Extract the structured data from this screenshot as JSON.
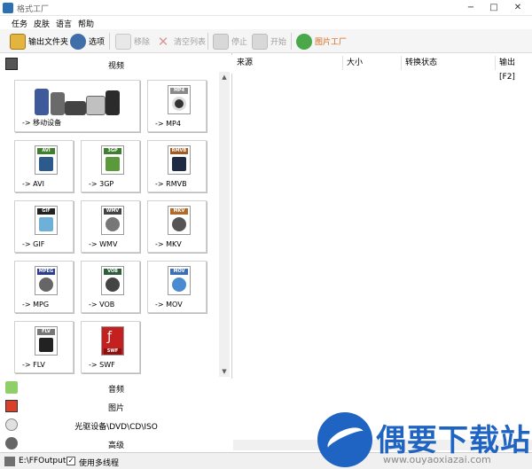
{
  "window": {
    "title": "格式工厂",
    "minimize": "−",
    "maximize": "□",
    "close": "✕"
  },
  "menu": [
    "任务",
    "皮肤",
    "语言",
    "帮助"
  ],
  "toolbar": {
    "output_folder": "输出文件夹",
    "options": "选项",
    "remove": "移除",
    "clear_list": "清空列表",
    "stop": "停止",
    "start": "开始",
    "picture_factory": "图片工厂"
  },
  "sidebar": {
    "video_label": "视频",
    "audio_label": "音频",
    "picture_label": "图片",
    "rom_label": "光驱设备\\DVD\\CD\\ISO",
    "advanced_label": "高级",
    "tiles": [
      {
        "label": "-> 移动设备",
        "tag": ""
      },
      {
        "label": "-> MP4",
        "tag": "MP4",
        "color": "#8a8a8a"
      },
      {
        "label": "-> AVI",
        "tag": "AVI",
        "color": "#3f7f2f"
      },
      {
        "label": "-> 3GP",
        "tag": "3GP",
        "color": "#3f7f2f"
      },
      {
        "label": "-> RMVB",
        "tag": "RMVB",
        "color": "#a05a22"
      },
      {
        "label": "-> GIF",
        "tag": "GIF",
        "color": "#222222"
      },
      {
        "label": "-> WMV",
        "tag": "WMV",
        "color": "#444444"
      },
      {
        "label": "-> MKV",
        "tag": "MKV",
        "color": "#b06a2a"
      },
      {
        "label": "-> MPG",
        "tag": "MPEG",
        "color": "#2d3f8c"
      },
      {
        "label": "-> VOB",
        "tag": "VOB",
        "color": "#2f5f3a"
      },
      {
        "label": "-> MOV",
        "tag": "MOV",
        "color": "#3b6fb5"
      },
      {
        "label": "-> FLV",
        "tag": "FLV",
        "color": "#777777"
      },
      {
        "label": "-> SWF",
        "tag": "SWF",
        "color": "#c52020"
      }
    ]
  },
  "table": {
    "columns": [
      "来源",
      "大小",
      "转换状态",
      "输出 [F2]"
    ]
  },
  "status": {
    "output_path": "E:\\FFOutput",
    "multithread_label": "使用多线程",
    "multithread_checked": "✓"
  },
  "watermark": {
    "title": "偶要下载站",
    "url": "www.ouyaoxiazai.com"
  }
}
